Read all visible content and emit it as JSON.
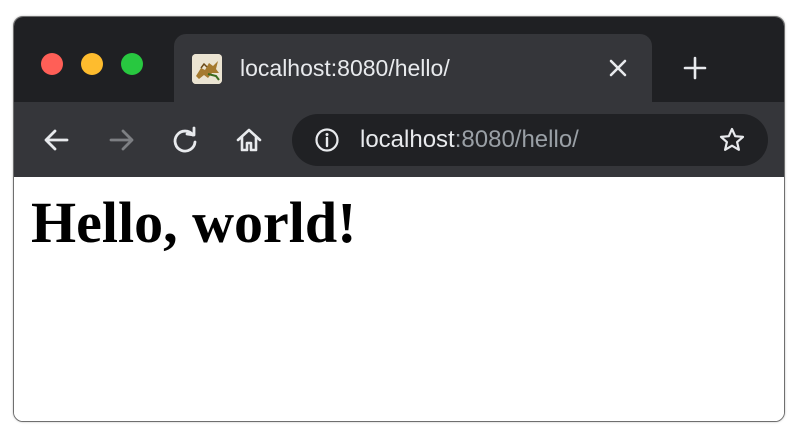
{
  "tab": {
    "title": "localhost:8080/hello/",
    "favicon": "tomcat-favicon-icon"
  },
  "toolbar": {
    "back": "arrow-left-icon",
    "forward": "arrow-right-icon",
    "reload": "reload-icon",
    "home": "home-icon"
  },
  "omnibox": {
    "url_host": "localhost",
    "url_rest": ":8080/hello/",
    "info": "info-icon",
    "bookmark": "star-icon"
  },
  "page": {
    "heading": "Hello, world!"
  },
  "colors": {
    "titlebar": "#1f2023",
    "tab": "#35363a",
    "toolbar": "#35363a",
    "omnibox": "#202124",
    "close": "#ff5f57",
    "minimize": "#febc2e",
    "maximize": "#28c840"
  }
}
